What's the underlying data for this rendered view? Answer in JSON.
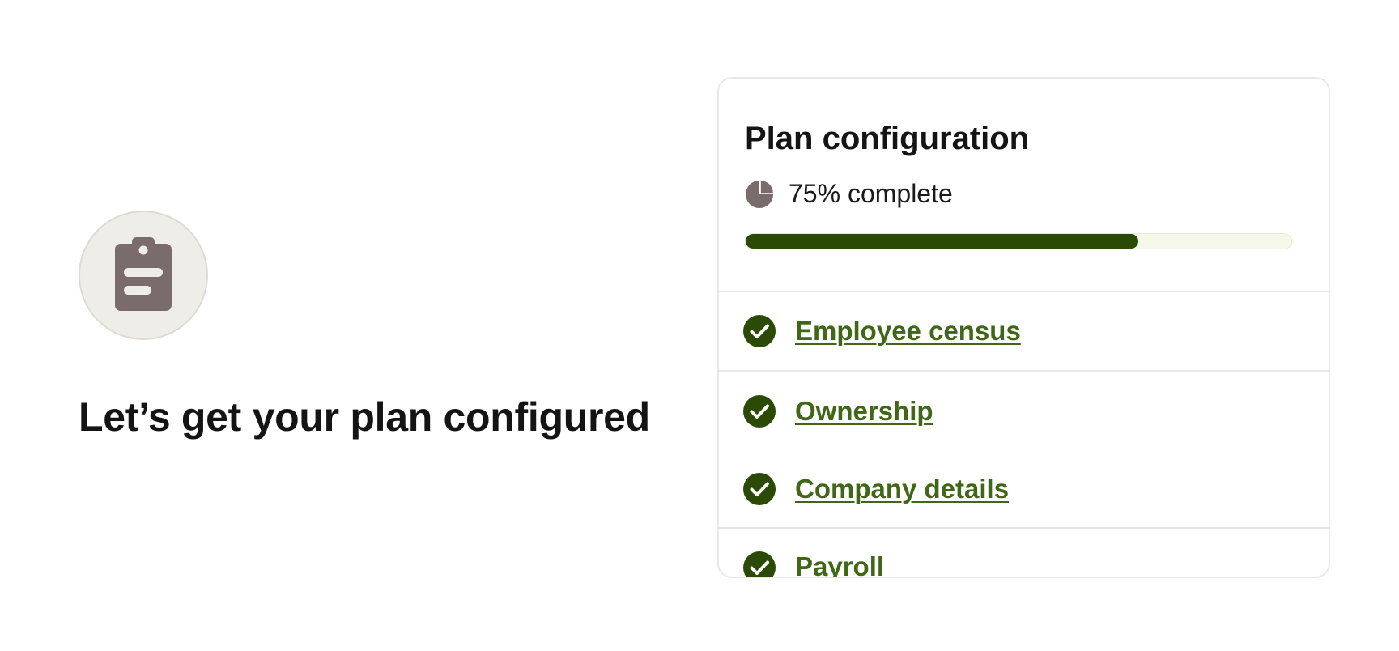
{
  "hero": {
    "icon": "clipboard-icon",
    "title": "Let’s get your plan configured"
  },
  "card": {
    "title": "Plan configuration",
    "progress": {
      "icon": "pie-progress-icon",
      "label": "75% complete",
      "fraction": 0.72
    },
    "steps": [
      {
        "label": "Employee census",
        "icon": "check-circle-icon",
        "status": "complete"
      },
      {
        "label": "Ownership",
        "icon": "check-circle-icon",
        "status": "complete"
      },
      {
        "label": "Company details",
        "icon": "check-circle-icon",
        "status": "complete"
      },
      {
        "label": "Payroll",
        "icon": "check-circle-icon",
        "status": "complete"
      }
    ]
  },
  "colors": {
    "accent_dark": "#2b4a06",
    "link_green": "#3f6716",
    "icon_muted": "#7a6c6a",
    "track_bg": "#f3f8e8"
  }
}
